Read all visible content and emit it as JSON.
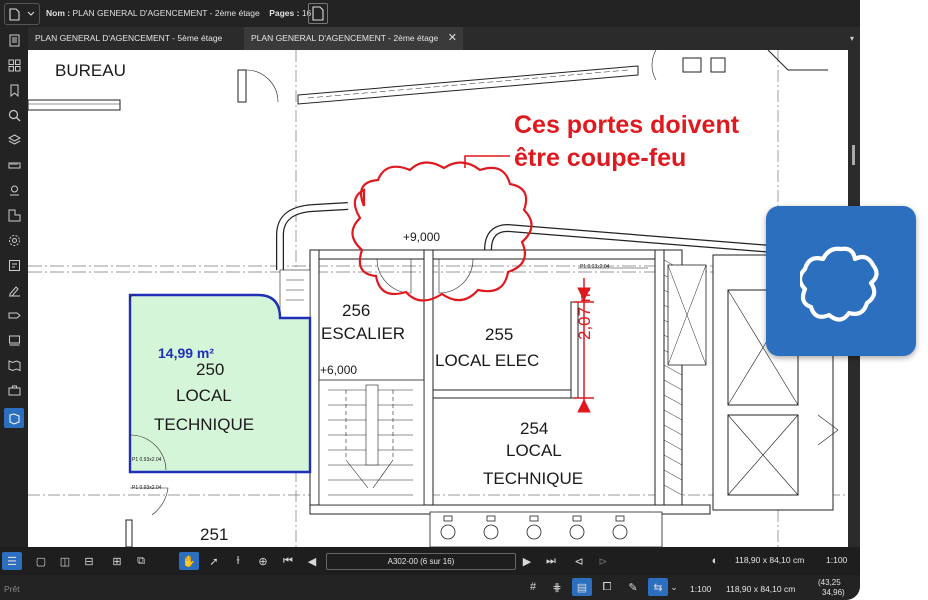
{
  "header": {
    "name_label": "Nom :",
    "name_value": "PLAN GENERAL D'AGENCEMENT - 2ème étage",
    "pages_label": "Pages :",
    "pages_value": "16"
  },
  "tabs": [
    {
      "label": "PLAN GENERAL D'AGENCEMENT - 5ème étage",
      "active": false
    },
    {
      "label": "PLAN GENERAL D'AGENCEMENT - 2ème étage",
      "active": true,
      "close_icon": "close-icon"
    }
  ],
  "sidebar_icons": [
    "document-icon",
    "thumbnails-icon",
    "bookmark-icon",
    "search-icon",
    "layers-icon",
    "ruler-icon",
    "location-icon",
    "area-icon",
    "settings-icon",
    "markup-list-icon",
    "signature-icon",
    "tag-icon",
    "stamp-icon",
    "map-icon",
    "toolchest-icon",
    "sketch-icon"
  ],
  "plan": {
    "rooms": {
      "bureau": "BUREAU",
      "r256_num": "256",
      "r256_name": "ESCALIER",
      "r255_num": "255",
      "r255_name": "LOCAL ELEC",
      "r250_area": "14,99 m²",
      "r250_num": "250",
      "r250_name_1": "LOCAL",
      "r250_name_2": "TECHNIQUE",
      "r254_num": "254",
      "r254_name_1": "LOCAL",
      "r254_name_2": "TECHNIQUE",
      "r251_num": "251"
    },
    "levels": {
      "top": "+9,000",
      "stair": "+6,000"
    },
    "door_tags": {
      "d1": "P1 0.93x2.04",
      "d2": "P1 0.93x2.04",
      "d3": "P1 0.93x2.04"
    },
    "annotation_line1": "Ces portes doivent",
    "annotation_line2": "être coupe-feu",
    "dimension": "2,07 m",
    "colors": {
      "markup_red": "#e0191f",
      "area_blue": "#1f2fb8",
      "area_fill": "#d5f5d9"
    }
  },
  "bottom_toolbar": {
    "page_field": "A302-00 (6 sur 16)",
    "size": "118,90 x 84,10 cm",
    "scale": "1:100"
  },
  "status_bar": {
    "status": "Prêt",
    "scale": "1:100",
    "size": "118,90 x 84,10 cm",
    "coord_x": "(43,25",
    "coord_y": "34,96)"
  },
  "floating_tool": {
    "icon": "cloud-icon"
  }
}
